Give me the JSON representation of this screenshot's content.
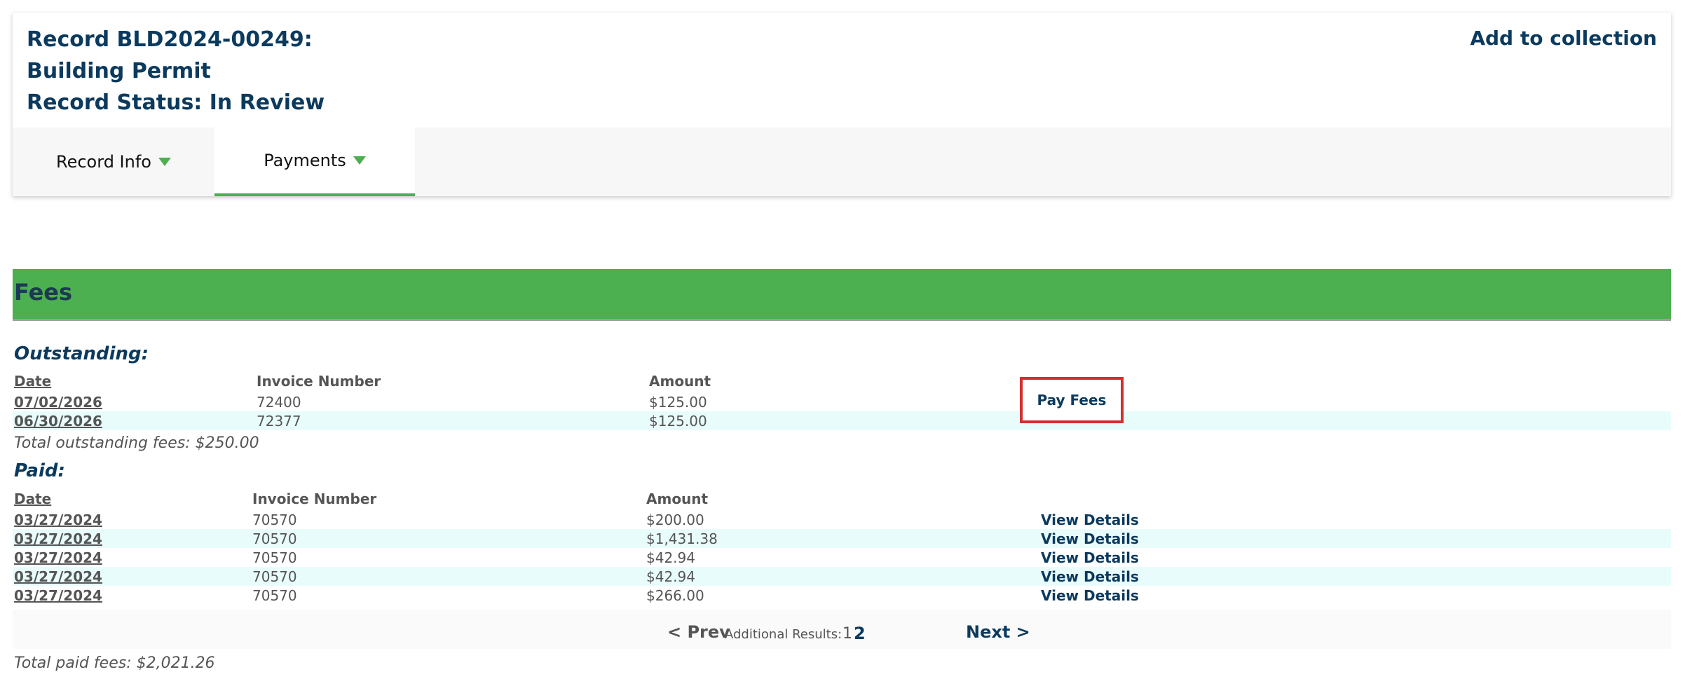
{
  "record": {
    "title_line1": "Record BLD2024-00249:",
    "title_line2": "Building Permit",
    "title_line3": "Record Status: In Review",
    "add_to_collection": "Add to collection"
  },
  "tabs": [
    {
      "label": "Record Info",
      "icon": "caret-down-icon"
    },
    {
      "label": "Payments",
      "icon": "caret-down-icon",
      "active": true
    }
  ],
  "fees": {
    "heading": "Fees",
    "outstanding": {
      "label": "Outstanding:",
      "columns": {
        "date": "Date",
        "invoice": "Invoice Number",
        "amount": "Amount"
      },
      "rows": [
        {
          "date": "07/02/2026",
          "invoice": "72400",
          "amount": "$125.00"
        },
        {
          "date": "06/30/2026",
          "invoice": "72377",
          "amount": "$125.00"
        }
      ],
      "pay_fees_label": "Pay Fees",
      "total": "Total outstanding fees: $250.00"
    },
    "paid": {
      "label": "Paid:",
      "columns": {
        "date": "Date",
        "invoice": "Invoice Number",
        "amount": "Amount"
      },
      "rows": [
        {
          "date": "03/27/2024",
          "invoice": "70570",
          "amount": "$200.00",
          "action": "View Details"
        },
        {
          "date": "03/27/2024",
          "invoice": "70570",
          "amount": "$1,431.38",
          "action": "View Details"
        },
        {
          "date": "03/27/2024",
          "invoice": "70570",
          "amount": "$42.94",
          "action": "View Details"
        },
        {
          "date": "03/27/2024",
          "invoice": "70570",
          "amount": "$42.94",
          "action": "View Details"
        },
        {
          "date": "03/27/2024",
          "invoice": "70570",
          "amount": "$266.00",
          "action": "View Details"
        }
      ],
      "total": "Total paid fees: $2,021.26"
    },
    "pagination": {
      "prev": "< Prev",
      "additional": "Additional Results:",
      "page1": "1",
      "page2": "2",
      "next": "Next >"
    }
  },
  "colors": {
    "accent": "#4caf50",
    "title": "#0b3a5e",
    "highlight_border": "#d32f2f",
    "alt_row": "#e9fcfc"
  }
}
